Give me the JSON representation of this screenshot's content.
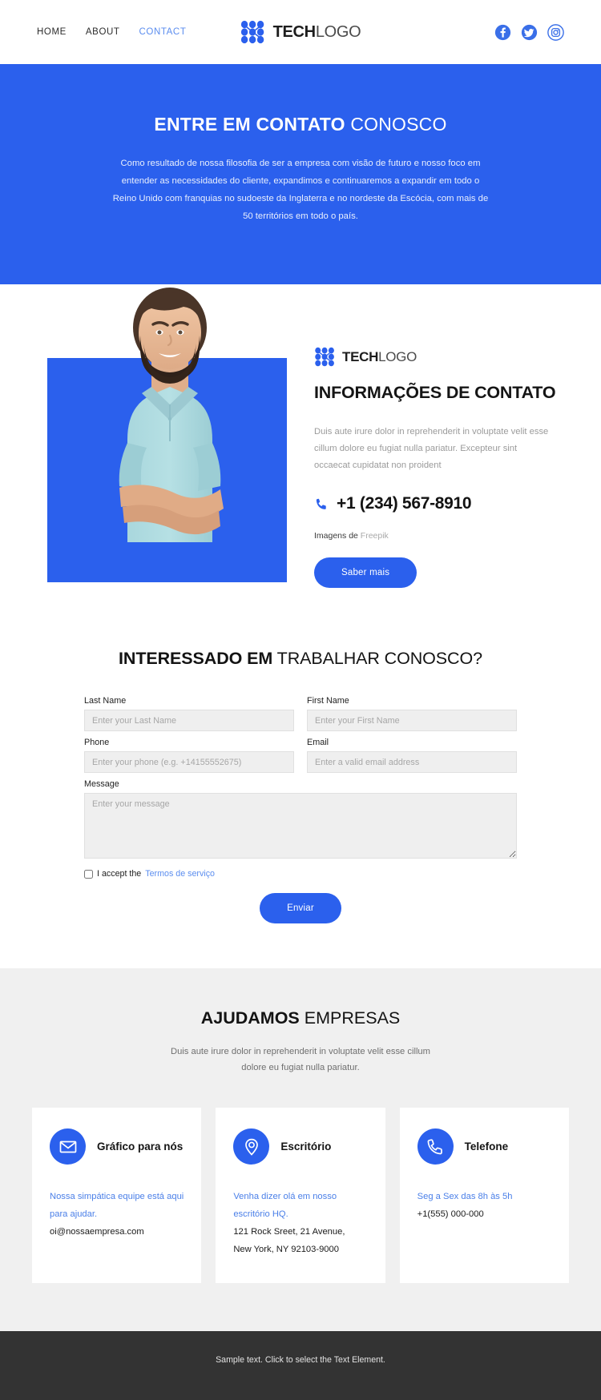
{
  "header": {
    "nav": [
      {
        "label": "HOME",
        "active": false
      },
      {
        "label": "ABOUT",
        "active": false
      },
      {
        "label": "CONTACT",
        "active": true
      }
    ],
    "brand": {
      "bold": "TECH",
      "light": "LOGO"
    },
    "socials": [
      {
        "name": "facebook-icon",
        "label": "Facebook"
      },
      {
        "name": "twitter-icon",
        "label": "Twitter"
      },
      {
        "name": "instagram-icon",
        "label": "Instagram"
      }
    ]
  },
  "hero": {
    "title_bold": "ENTRE EM CONTATO",
    "title_light": "CONOSCO",
    "paragraph": "Como resultado de nossa filosofia de ser a empresa com visão de futuro e nosso foco em entender as necessidades do cliente, expandimos e continuaremos a expandir em todo o Reino Unido com franquias no sudoeste da Inglaterra e no nordeste da Escócia, com mais de 50 territórios em todo o país."
  },
  "info": {
    "brand": {
      "bold": "TECH",
      "light": "LOGO"
    },
    "title": "INFORMAÇÕES DE CONTATO",
    "description": "Duis aute irure dolor in reprehenderit in voluptate velit esse cillum dolore eu fugiat nulla pariatur. Excepteur sint occaecat cupidatat non proident",
    "phone": "+1 (234) 567-8910",
    "credit_prefix": "Imagens de",
    "credit_link": "Freepik",
    "button": "Saber mais",
    "photo_alt": "Homem sorridente de braços cruzados"
  },
  "form": {
    "heading_bold": "INTERESSADO EM",
    "heading_light": "TRABALHAR CONOSCO?",
    "fields": {
      "last_name": {
        "label": "Last Name",
        "placeholder": "Enter your Last Name",
        "value": ""
      },
      "first_name": {
        "label": "First Name",
        "placeholder": "Enter your First Name",
        "value": ""
      },
      "phone": {
        "label": "Phone",
        "placeholder": "Enter your phone (e.g. +14155552675)",
        "value": ""
      },
      "email": {
        "label": "Email",
        "placeholder": "Enter a valid email address",
        "value": ""
      },
      "message": {
        "label": "Message",
        "placeholder": "Enter your message",
        "value": ""
      }
    },
    "accept_text": "I accept the",
    "accept_link": "Termos de serviço",
    "submit": "Enviar"
  },
  "help": {
    "title_bold": "AJUDAMOS",
    "title_light": "EMPRESAS",
    "subtitle": "Duis aute irure dolor in reprehenderit in voluptate velit esse cillum dolore eu fugiat nulla pariatur.",
    "cards": [
      {
        "icon": "envelope-icon",
        "title": "Gráfico para nós",
        "blue_lines": [
          "Nossa simpática equipe está aqui para ajudar."
        ],
        "dark_lines": [
          "oi@nossaempresa.com"
        ]
      },
      {
        "icon": "map-pin-icon",
        "title": "Escritório",
        "blue_lines": [
          "Venha dizer olá em nosso escritório HQ."
        ],
        "dark_lines": [
          "121 Rock Sreet, 21 Avenue,",
          "New York, NY 92103-9000"
        ]
      },
      {
        "icon": "phone-icon",
        "title": "Telefone",
        "blue_lines": [
          "Seg a Sex das 8h às 5h"
        ],
        "dark_lines": [
          "+1(555) 000-000"
        ]
      }
    ]
  },
  "footer": {
    "text": "Sample text. Click to select the Text Element."
  },
  "colors": {
    "brand_blue": "#2b60ed",
    "link_blue": "#5b8def",
    "light_gray_bg": "#f0f0f0",
    "footer_bg": "#333333",
    "input_bg": "#efefef"
  }
}
